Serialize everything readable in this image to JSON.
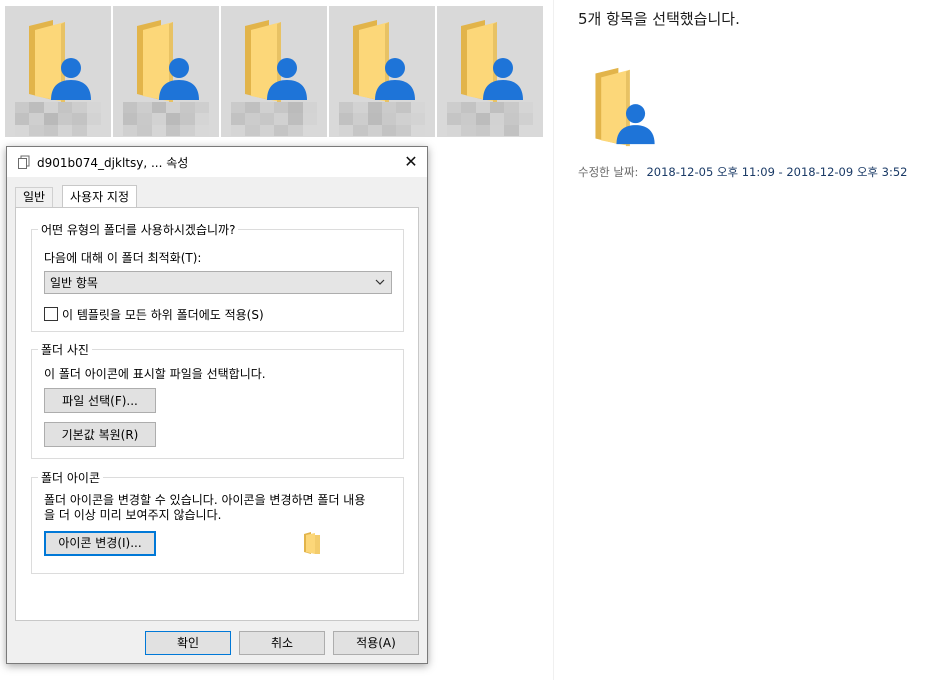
{
  "thumbnails": [
    {
      "name": "folder-1"
    },
    {
      "name": "folder-2"
    },
    {
      "name": "folder-3"
    },
    {
      "name": "folder-4"
    },
    {
      "name": "folder-5"
    }
  ],
  "details": {
    "title": "5개 항목을 선택했습니다.",
    "modified_label": "수정한 날짜:",
    "modified_value": "2018-12-05 오후 11:09 - 2018-12-09 오후 3:52"
  },
  "dialog": {
    "title": "d901b074_djkltsy, ... 속성",
    "close_glyph": "✕",
    "tabs": [
      {
        "label": "일반",
        "active": false
      },
      {
        "label": "사용자 지정",
        "active": true
      }
    ],
    "folder_type": {
      "legend": "어떤 유형의 폴더를 사용하시겠습니까?",
      "optimize_label": "다음에 대해 이 폴더 최적화(T):",
      "selected_option": "일반 항목",
      "apply_template_label": "이 템플릿을 모든 하위 폴더에도 적용(S)"
    },
    "folder_picture": {
      "legend": "폴더 사진",
      "description": "이 폴더 아이콘에 표시할 파일을 선택합니다.",
      "choose_file_button": "파일 선택(F)...",
      "restore_default_button": "기본값 복원(R)"
    },
    "folder_icon": {
      "legend": "폴더 아이콘",
      "description_line1": "폴더 아이콘을 변경할 수 있습니다. 아이콘을 변경하면 폴더 내용",
      "description_line2": "을 더 이상  미리 보여주지 않습니다.",
      "change_icon_button": "아이콘 변경(I)..."
    },
    "footer": {
      "ok": "확인",
      "cancel": "취소",
      "apply": "적용(A)"
    }
  },
  "colors": {
    "folder_back": "#e7bd55",
    "folder_front": "#fcd779",
    "user_badge": "#1e74d8",
    "accent": "#0078d7"
  }
}
